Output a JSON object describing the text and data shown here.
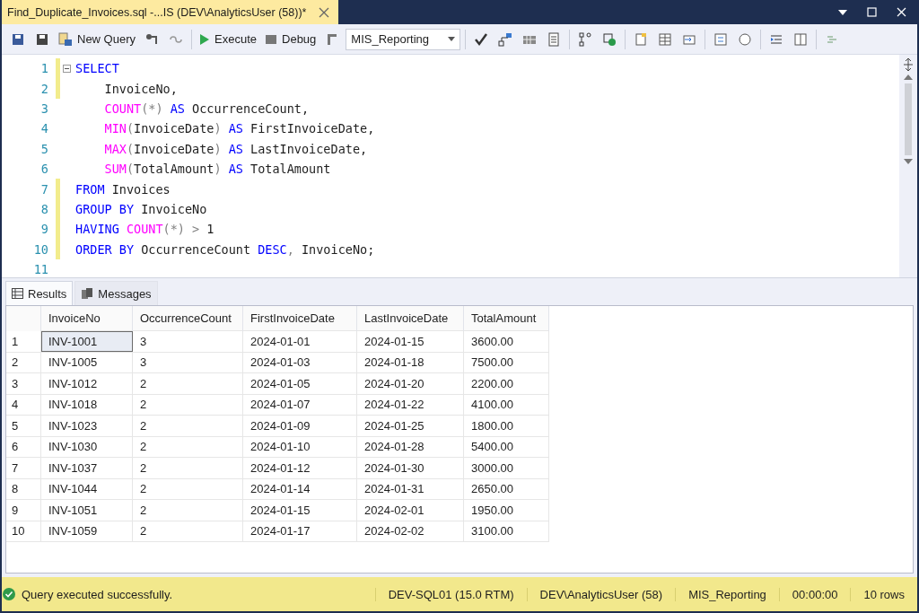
{
  "window": {
    "tab_title": "Find_Duplicate_Invoices.sql -...IS (DEV\\AnalyticsUser (58))*"
  },
  "toolbar": {
    "new_query": "New Query",
    "execute": "Execute",
    "debug": "Debug",
    "database": "MIS_Reporting"
  },
  "editor": {
    "lines": [
      {
        "number": "1",
        "changed": true,
        "tokens": [
          {
            "kind": "kw",
            "text": "SELECT"
          }
        ]
      },
      {
        "number": "2",
        "changed": true,
        "indented": true,
        "tokens": [
          {
            "kind": "plain",
            "text": "InvoiceNo,"
          }
        ]
      },
      {
        "number": "3",
        "changed": false,
        "indented": true,
        "tokens": [
          {
            "kind": "fn",
            "text": "COUNT"
          },
          {
            "kind": "op",
            "text": "(*) "
          },
          {
            "kind": "kw",
            "text": "AS"
          },
          {
            "kind": "plain",
            "text": " OccurrenceCount,"
          }
        ]
      },
      {
        "number": "4",
        "changed": false,
        "indented": true,
        "tokens": [
          {
            "kind": "fn",
            "text": "MIN"
          },
          {
            "kind": "op",
            "text": "("
          },
          {
            "kind": "plain",
            "text": "InvoiceDate"
          },
          {
            "kind": "op",
            "text": ") "
          },
          {
            "kind": "kw",
            "text": "AS"
          },
          {
            "kind": "plain",
            "text": " FirstInvoiceDate,"
          }
        ]
      },
      {
        "number": "5",
        "changed": false,
        "indented": true,
        "tokens": [
          {
            "kind": "fn",
            "text": "MAX"
          },
          {
            "kind": "op",
            "text": "("
          },
          {
            "kind": "plain",
            "text": "InvoiceDate"
          },
          {
            "kind": "op",
            "text": ") "
          },
          {
            "kind": "kw",
            "text": "AS"
          },
          {
            "kind": "plain",
            "text": " LastInvoiceDate,"
          }
        ]
      },
      {
        "number": "6",
        "changed": false,
        "indented": true,
        "tokens": [
          {
            "kind": "fn",
            "text": "SUM"
          },
          {
            "kind": "op",
            "text": "("
          },
          {
            "kind": "plain",
            "text": "TotalAmount"
          },
          {
            "kind": "op",
            "text": ") "
          },
          {
            "kind": "kw",
            "text": "AS"
          },
          {
            "kind": "plain",
            "text": " TotalAmount"
          }
        ]
      },
      {
        "number": "7",
        "changed": true,
        "tokens": [
          {
            "kind": "kw",
            "text": "FROM"
          },
          {
            "kind": "plain",
            "text": " Invoices"
          }
        ]
      },
      {
        "number": "8",
        "changed": true,
        "tokens": [
          {
            "kind": "kw",
            "text": "GROUP BY"
          },
          {
            "kind": "plain",
            "text": " InvoiceNo"
          }
        ]
      },
      {
        "number": "9",
        "changed": true,
        "tokens": [
          {
            "kind": "kw",
            "text": "HAVING "
          },
          {
            "kind": "fn",
            "text": "COUNT"
          },
          {
            "kind": "op",
            "text": "(*) >"
          },
          {
            "kind": "plain",
            "text": " 1"
          }
        ]
      },
      {
        "number": "10",
        "changed": true,
        "tokens": [
          {
            "kind": "kw",
            "text": "ORDER BY"
          },
          {
            "kind": "plain",
            "text": " OccurrenceCount "
          },
          {
            "kind": "kw",
            "text": "DESC"
          },
          {
            "kind": "op",
            "text": ","
          },
          {
            "kind": "plain",
            "text": " InvoiceNo;"
          }
        ]
      },
      {
        "number": "11",
        "changed": false
      }
    ]
  },
  "result_tabs": [
    {
      "label": "Results",
      "kind": "grid",
      "selected": true
    },
    {
      "label": "Messages",
      "kind": "messages",
      "selected": false
    }
  ],
  "table": {
    "columns": [
      "InvoiceNo",
      "OccurrenceCount",
      "FirstInvoiceDate",
      "LastInvoiceDate",
      "TotalAmount"
    ],
    "rows": [
      {
        "number": "1",
        "selected": true,
        "cells": [
          "INV-1001",
          "3",
          "2024-01-01",
          "2024-01-15",
          "3600.00"
        ]
      },
      {
        "number": "2",
        "selected": false,
        "cells": [
          "INV-1005",
          "3",
          "2024-01-03",
          "2024-01-18",
          "7500.00"
        ]
      },
      {
        "number": "3",
        "selected": false,
        "cells": [
          "INV-1012",
          "2",
          "2024-01-05",
          "2024-01-20",
          "2200.00"
        ]
      },
      {
        "number": "4",
        "selected": false,
        "cells": [
          "INV-1018",
          "2",
          "2024-01-07",
          "2024-01-22",
          "4100.00"
        ]
      },
      {
        "number": "5",
        "selected": false,
        "cells": [
          "INV-1023",
          "2",
          "2024-01-09",
          "2024-01-25",
          "1800.00"
        ]
      },
      {
        "number": "6",
        "selected": false,
        "cells": [
          "INV-1030",
          "2",
          "2024-01-10",
          "2024-01-28",
          "5400.00"
        ]
      },
      {
        "number": "7",
        "selected": false,
        "cells": [
          "INV-1037",
          "2",
          "2024-01-12",
          "2024-01-30",
          "3000.00"
        ]
      },
      {
        "number": "8",
        "selected": false,
        "cells": [
          "INV-1044",
          "2",
          "2024-01-14",
          "2024-01-31",
          "2650.00"
        ]
      },
      {
        "number": "9",
        "selected": false,
        "cells": [
          "INV-1051",
          "2",
          "2024-01-15",
          "2024-02-01",
          "1950.00"
        ]
      },
      {
        "number": "10",
        "selected": false,
        "cells": [
          "INV-1059",
          "2",
          "2024-01-17",
          "2024-02-02",
          "3100.00"
        ]
      }
    ]
  },
  "status_bar": {
    "message": "Query executed successfully.",
    "segments": [
      "DEV-SQL01 (15.0 RTM)",
      "DEV\\AnalyticsUser (58)",
      "MIS_Reporting",
      "00:00:00",
      "10 rows"
    ]
  }
}
